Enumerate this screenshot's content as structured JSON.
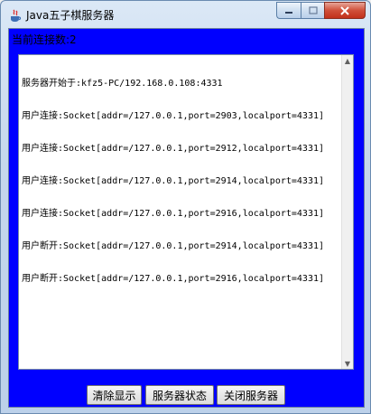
{
  "window": {
    "title": "Java五子棋服务器"
  },
  "status": {
    "connections_label": "当前连接数:2"
  },
  "log": {
    "lines": [
      "服务器开始于:kfz5-PC/192.168.0.108:4331",
      "用户连接:Socket[addr=/127.0.0.1,port=2903,localport=4331]",
      "用户连接:Socket[addr=/127.0.0.1,port=2912,localport=4331]",
      "用户连接:Socket[addr=/127.0.0.1,port=2914,localport=4331]",
      "用户连接:Socket[addr=/127.0.0.1,port=2916,localport=4331]",
      "用户断开:Socket[addr=/127.0.0.1,port=2914,localport=4331]",
      "用户断开:Socket[addr=/127.0.0.1,port=2916,localport=4331]"
    ]
  },
  "buttons": {
    "clear_label": "清除显示",
    "status_label": "服务器状态",
    "close_label": "关闭服务器"
  },
  "colors": {
    "panel_background": "#0000ff",
    "close_button": "#c2301a"
  }
}
